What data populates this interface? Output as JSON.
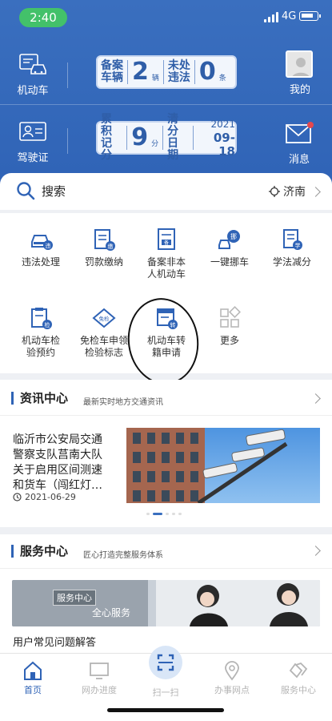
{
  "status": {
    "time": "2:40",
    "network": "4G"
  },
  "header": {
    "vehicle_label": "机动车",
    "license_label": "驾驶证",
    "mine_label": "我的",
    "message_label": "消息",
    "panel1": {
      "l1": "备案",
      "l2": "车辆",
      "count": "2",
      "unit": "辆",
      "r1": "未处",
      "r2": "违法",
      "count2": "0",
      "unit2": "条"
    },
    "panel2": {
      "l1": "累积",
      "l2": "记分",
      "count": "9",
      "unit": "分",
      "r1": "清分",
      "r2": "日期",
      "year": "2021",
      "date": "09-18"
    }
  },
  "search": {
    "placeholder": "搜索",
    "city": "济南"
  },
  "services": [
    {
      "label": "违法处理"
    },
    {
      "label": "罚款缴纳"
    },
    {
      "label": "备案非本\n人机动车"
    },
    {
      "label": "一键挪车"
    },
    {
      "label": "学法减分"
    },
    {
      "label": "机动车检\n验预约"
    },
    {
      "label": "免检车申领\n检验标志"
    },
    {
      "label": "机动车转\n籍申请"
    },
    {
      "label": "更多"
    }
  ],
  "icon_badges": {
    "violation": "违",
    "fine": "缴",
    "record": "备",
    "move": "挪",
    "study": "学",
    "inspect": "检",
    "exempt": "免检",
    "transfer": "转"
  },
  "news": {
    "title": "资讯中心",
    "subtitle": "最新实时地方交通资讯",
    "headline": "临沂市公安局交通警察支队莒南大队关于启用区间测速和货车（闯红灯…",
    "date": "2021-06-29"
  },
  "service_center": {
    "title": "服务中心",
    "subtitle": "匠心打造完整服务体系",
    "banner_tag": "服务中心",
    "banner_text": "全心服务",
    "faq": "用户常见问题解答"
  },
  "tabs": [
    {
      "label": "首页"
    },
    {
      "label": "网办进度"
    },
    {
      "label": "扫一扫"
    },
    {
      "label": "办事网点"
    },
    {
      "label": "服务中心"
    }
  ],
  "colors": {
    "brand": "#2f63b6",
    "status_green": "#43c16a",
    "badge_red": "#e5484d"
  }
}
